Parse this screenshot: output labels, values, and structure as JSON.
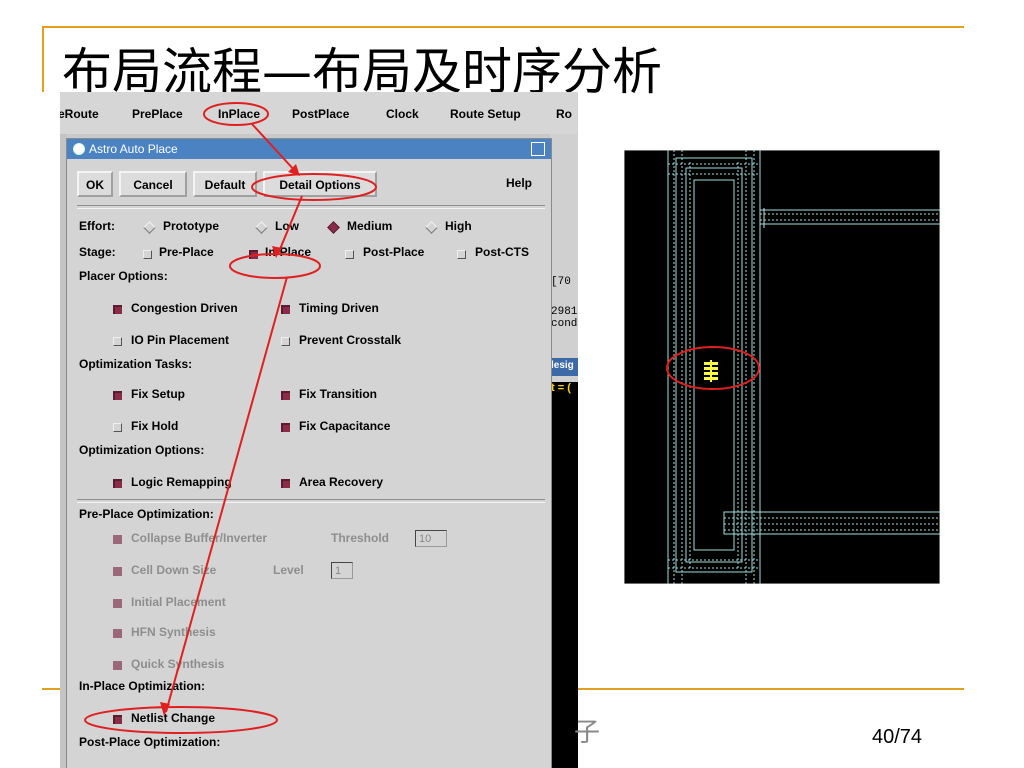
{
  "slide": {
    "title": "布局流程—布局及时序分析",
    "page": "40/74",
    "partial_char": "子"
  },
  "menubar": {
    "items": [
      "eRoute",
      "PrePlace",
      "InPlace",
      "PostPlace",
      "Clock",
      "Route Setup",
      "Ro"
    ]
  },
  "background_fragments": {
    "bracket_text": "[70",
    "num_text": "2981",
    "cond_text": "cond",
    "blue_text": "lesig",
    "eq_text": "t = ("
  },
  "dialog": {
    "title": "Astro Auto Place",
    "buttons": {
      "ok": "OK",
      "cancel": "Cancel",
      "default": "Default",
      "detail": "Detail Options",
      "help": "Help"
    },
    "effort": {
      "label": "Effort:",
      "options": [
        "Prototype",
        "Low",
        "Medium",
        "High"
      ],
      "selected": "Medium"
    },
    "stage": {
      "label": "Stage:",
      "options": [
        "Pre-Place",
        "In-Place",
        "Post-Place",
        "Post-CTS"
      ],
      "selected": "In-Place"
    },
    "placer_options": {
      "label": "Placer Options:",
      "congestion": "Congestion Driven",
      "timing": "Timing Driven",
      "io_pin": "IO Pin Placement",
      "crosstalk": "Prevent Crosstalk"
    },
    "optimization_tasks": {
      "label": "Optimization Tasks:",
      "fix_setup": "Fix Setup",
      "fix_transition": "Fix Transition",
      "fix_hold": "Fix Hold",
      "fix_capacitance": "Fix Capacitance"
    },
    "optimization_options": {
      "label": "Optimization Options:",
      "logic_remapping": "Logic Remapping",
      "area_recovery": "Area Recovery"
    },
    "pre_place": {
      "label": "Pre-Place Optimization:",
      "collapse": "Collapse Buffer/Inverter",
      "threshold_label": "Threshold",
      "threshold_value": "10",
      "cell_down": "Cell Down Size",
      "level_label": "Level",
      "level_value": "1",
      "initial": "Initial Placement",
      "hfn": "HFN Synthesis",
      "quick": "Quick Synthesis"
    },
    "in_place": {
      "label": "In-Place Optimization:",
      "netlist": "Netlist Change"
    },
    "post_place": {
      "label": "Post-Place Optimization:"
    }
  },
  "colors": {
    "accent_line": "#e0a020",
    "annotation_red": "#e02020",
    "title_bar": "#4a82c2",
    "checked": "#8a2c48",
    "layout_wire": "#9fdfdf",
    "layout_cell": "#ffff40"
  }
}
